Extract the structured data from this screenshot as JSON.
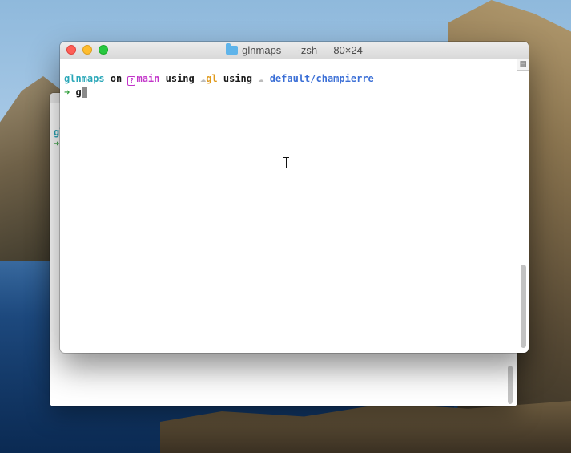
{
  "window": {
    "title": "glnmaps — -zsh — 80×24",
    "folder_icon": "folder-icon",
    "tab_overview_icon": "tab-overview-icon"
  },
  "prompt": {
    "dir": "glnmaps",
    "on": " on ",
    "branch_icon": "?",
    "branch": "main",
    "using1": " using ",
    "cloud1": "☁",
    "gcp": "gl",
    "using2": " using ",
    "cloud2": "☁",
    "context": " default/champierre",
    "arrow": "➜",
    "input": " g"
  },
  "back_window": {
    "dir_fragment": "gl",
    "arrow": "➜"
  },
  "colors": {
    "dir": "#2aa7b8",
    "branch": "#c233c9",
    "gcp": "#e09a1b",
    "context": "#3b6fd6",
    "arrow": "#2f9d3a"
  }
}
